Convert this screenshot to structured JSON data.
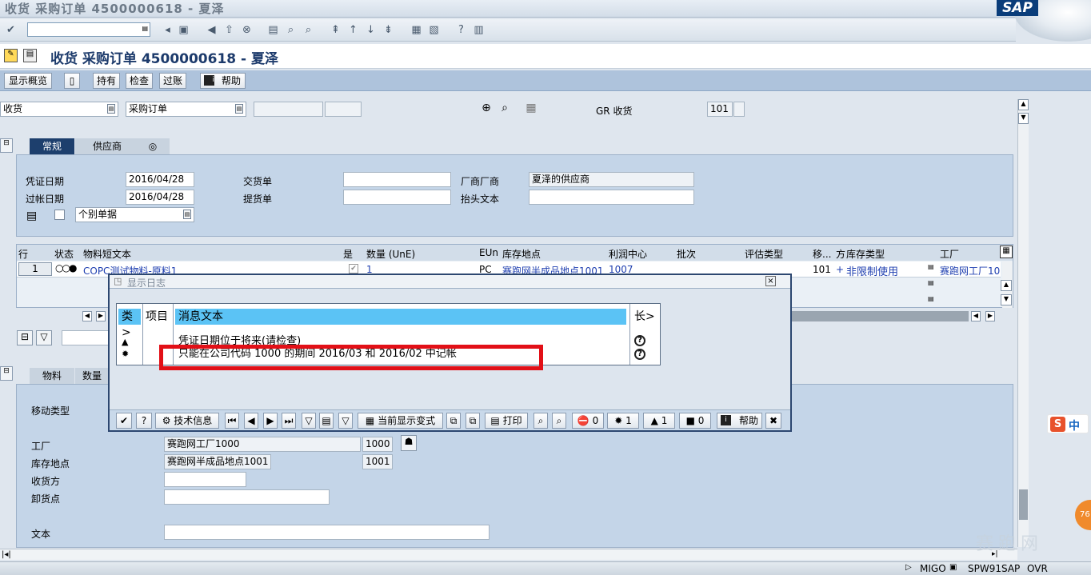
{
  "window": {
    "title": "收货 采购订单 4500000618 - 夏泽",
    "logo": "SAP"
  },
  "header": {
    "title": "收货 采购订单 4500000618 - 夏泽"
  },
  "appbar": {
    "display_overview": "显示概览",
    "hold": "持有",
    "check": "检查",
    "post": "过账",
    "help": "帮助"
  },
  "selection": {
    "action": "收货",
    "reference": "采购订单",
    "field3": "",
    "field4": "",
    "gr_label": "GR 收货",
    "movement_type": "101",
    "movement_ext": ""
  },
  "tabs": {
    "general": "常规",
    "vendor": "供应商"
  },
  "general": {
    "doc_date_label": "凭证日期",
    "doc_date": "2016/04/28",
    "post_date_label": "过帐日期",
    "post_date": "2016/04/28",
    "delivery_note_label": "交货单",
    "delivery_note": "",
    "bill_of_lading_label": "提货单",
    "bill_of_lading": "",
    "vendor_label": "厂商厂商",
    "vendor": "夏泽的供应商",
    "header_text_label": "抬头文本",
    "header_text": "",
    "print_option": "个别单据"
  },
  "items_table": {
    "columns": [
      "行",
      "状态",
      "物料短文本",
      "是",
      "数量 (UnE)",
      "EUn",
      "库存地点",
      "利润中心",
      "批次",
      "评估类型",
      "移...",
      "方",
      "库存类型",
      "工厂"
    ],
    "rows": [
      {
        "line": "1",
        "status": "",
        "text": "COPC测试物料-原料1",
        "ok": "",
        "qty": "1",
        "eun": "PC",
        "sloc": "赛跑网半成品地点1001",
        "profit_center": "1007",
        "batch": "",
        "valuation": "",
        "mvt": "101",
        "sign": "+",
        "stock_type": "非限制使用",
        "plant": "赛跑网工厂10"
      }
    ]
  },
  "detail_tabs": {
    "material": "物料",
    "quantity": "数量"
  },
  "detail": {
    "movement_type_label": "移动类型",
    "plant_label": "工厂",
    "plant": "赛跑网工厂1000",
    "plant_code": "1000",
    "sloc_label": "库存地点",
    "sloc": "赛跑网半成品地点1001",
    "sloc_code": "1001",
    "recipient_label": "收货方",
    "recipient": "",
    "unload_label": "卸货点",
    "unload": "",
    "text_label": "文本",
    "text": ""
  },
  "dialog": {
    "title": "显示日志",
    "col_type": "类>",
    "col_item": "项目",
    "col_msg": "消息文本",
    "col_long": "长>",
    "messages": [
      {
        "type_icon": "warning-triangle",
        "text": "凭证日期位于将来(请检查)"
      },
      {
        "type_icon": "error-bomb",
        "text": "只能在公司代码 1000 的期间 2016/03 和 2016/02 中记帐"
      }
    ],
    "buttons": {
      "tech_info": "技术信息",
      "current_variant": "当前显示变式",
      "print": "打印",
      "stop_count": "0",
      "error_count": "1",
      "warning_count": "1",
      "info_count": "0",
      "help": "帮助"
    }
  },
  "status": {
    "transaction": "MIGO",
    "system": "SPW91SAP",
    "mode": "OVR"
  },
  "ime": {
    "label": "中",
    "badge": "76"
  },
  "watermark": "赛跑网"
}
